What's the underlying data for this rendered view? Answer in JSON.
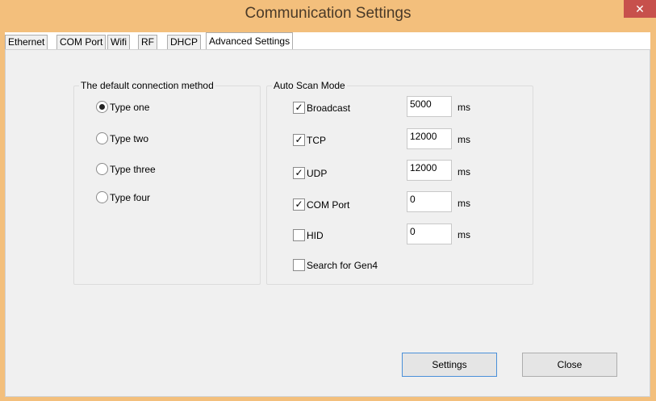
{
  "window": {
    "title": "Communication Settings",
    "close_glyph": "✕"
  },
  "tabs": [
    {
      "label": "Ethernet"
    },
    {
      "label": "COM Port"
    },
    {
      "label": "Wifi"
    },
    {
      "label": "RF"
    },
    {
      "label": "DHCP"
    },
    {
      "label": "Advanced Settings",
      "active": true
    }
  ],
  "connection_group": {
    "title": "The default connection method",
    "options": [
      {
        "label": "Type one",
        "selected": true
      },
      {
        "label": "Type two",
        "selected": false
      },
      {
        "label": "Type three",
        "selected": false
      },
      {
        "label": "Type four",
        "selected": false
      }
    ]
  },
  "scan_group": {
    "title": "Auto Scan Mode",
    "items": [
      {
        "label": "Broadcast",
        "checked": true,
        "value": "5000",
        "unit": "ms"
      },
      {
        "label": "TCP",
        "checked": true,
        "value": "12000",
        "unit": "ms"
      },
      {
        "label": "UDP",
        "checked": true,
        "value": "12000",
        "unit": "ms"
      },
      {
        "label": "COM Port",
        "checked": true,
        "value": "0",
        "unit": "ms"
      },
      {
        "label": "HID",
        "checked": false,
        "value": "0",
        "unit": "ms"
      }
    ],
    "gen4": {
      "label": "Search for Gen4",
      "checked": false
    }
  },
  "buttons": {
    "settings_label": "Settings",
    "close_label": "Close"
  },
  "colors": {
    "title_bar": "#f3bf7c",
    "close_button": "#c7504c",
    "panel": "#f0f0f0"
  }
}
